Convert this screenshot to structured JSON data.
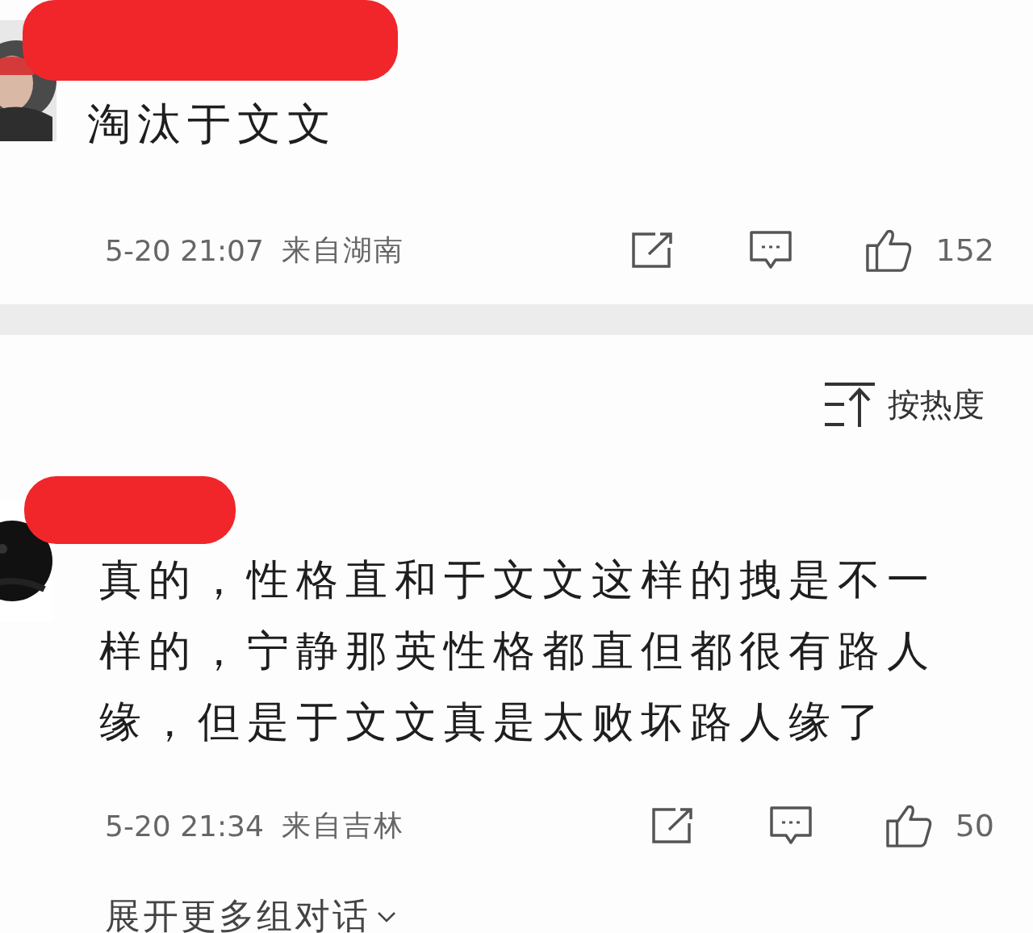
{
  "comments": [
    {
      "name_redacted": true,
      "text": "淘汰于文文",
      "time": "5-20 21:07",
      "location": "来自湖南",
      "likes": "152"
    }
  ],
  "sort": {
    "label": "按热度"
  },
  "replies": [
    {
      "name_redacted": true,
      "text": "真的，性格直和于文文这样的拽是不一样的，宁静那英性格都直但都很有路人缘，但是于文文真是太败坏路人缘了",
      "time": "5-20 21:34",
      "location": "来自吉林",
      "likes": "50"
    }
  ],
  "expand_link": "展开更多组对话"
}
